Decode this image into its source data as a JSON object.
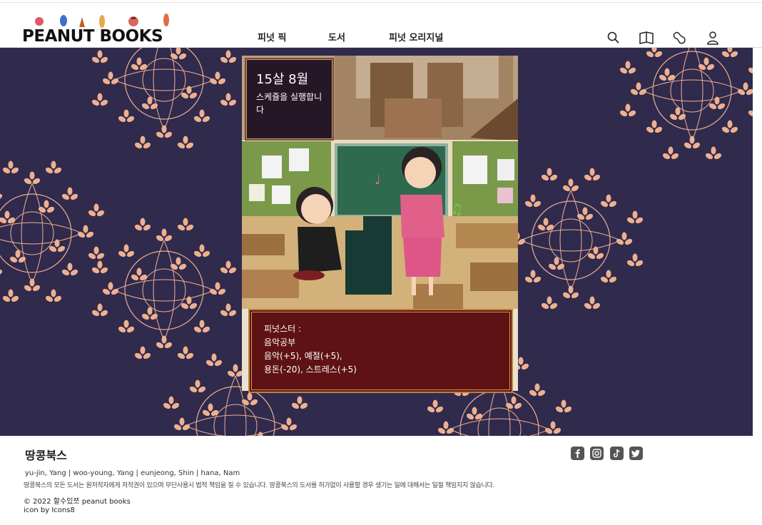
{
  "header": {
    "logo_text": "PEANUT BOOKS",
    "nav": [
      {
        "label": "피넛 픽"
      },
      {
        "label": "도서"
      },
      {
        "label": "피넛 오리지널"
      }
    ],
    "icons": [
      "search-icon",
      "book-icon",
      "peanut-icon",
      "user-icon"
    ]
  },
  "game": {
    "date_main": "15살 8월",
    "date_sub": "스케쥴을 실행합니다",
    "message": {
      "speaker": "피넛스터 :",
      "action": "음악공부",
      "effects_line1": "음악(+5), 예절(+5),",
      "effects_line2": "용돈(-20), 스트레스(+5)"
    }
  },
  "footer": {
    "title": "땅콩북스",
    "names": "yu-jin, Yang  |  woo-young, Yang  |  eunjeong, Shin  |  hana, Nam",
    "notice": "땅콩북스의 모든 도서는 원저작자에게 저작권이 있으며 무단사용시 법적 책임을 질 수 있습니다. 땅콩북스의 도서를 허가없이 사용할 경우 생기는 일에 대해서는 일절 책임지지 않습니다.",
    "copyright": "© 2022 할수있쪼 peanut books",
    "icon_credit": "icon by Icons8",
    "social": [
      "facebook-icon",
      "instagram-icon",
      "tiktok-icon",
      "twitter-icon"
    ]
  },
  "colors": {
    "stage_bg": "#302a4d",
    "flower": "#eeb08f",
    "message_bg": "#5f1213",
    "date_bg": "#261726"
  }
}
